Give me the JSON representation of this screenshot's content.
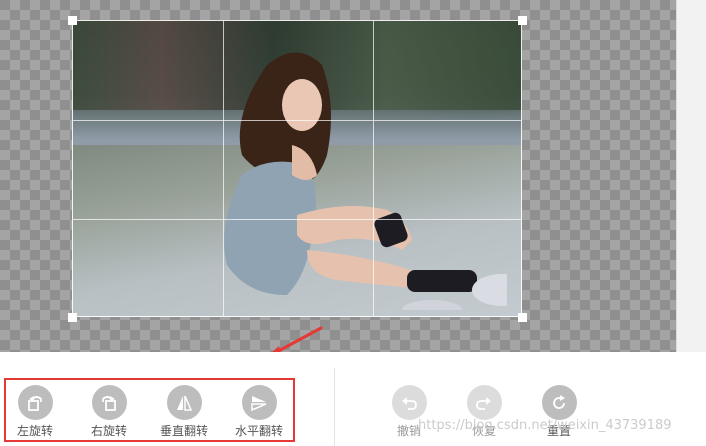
{
  "canvas": {
    "checker_light": "#a4a4a4",
    "checker_dark": "#8f8f8f"
  },
  "image": {
    "description_icon": "photo-thumbnail",
    "crop_grid": "3x3"
  },
  "tools_left": [
    {
      "label": "左旋转",
      "icon": "rotate-left-icon"
    },
    {
      "label": "右旋转",
      "icon": "rotate-right-icon"
    },
    {
      "label": "垂直翻转",
      "icon": "flip-vertical-icon"
    },
    {
      "label": "水平翻转",
      "icon": "flip-horizontal-icon"
    }
  ],
  "tools_right": [
    {
      "label": "撤销",
      "icon": "undo-icon",
      "enabled": false
    },
    {
      "label": "恢复",
      "icon": "redo-icon",
      "enabled": false
    },
    {
      "label": "重置",
      "icon": "reset-icon",
      "enabled": true
    }
  ],
  "annotation": {
    "arrow_color": "#e53935",
    "highlight_color": "#e53935"
  },
  "watermark": "https://blog.csdn.net/weixin_43739189"
}
